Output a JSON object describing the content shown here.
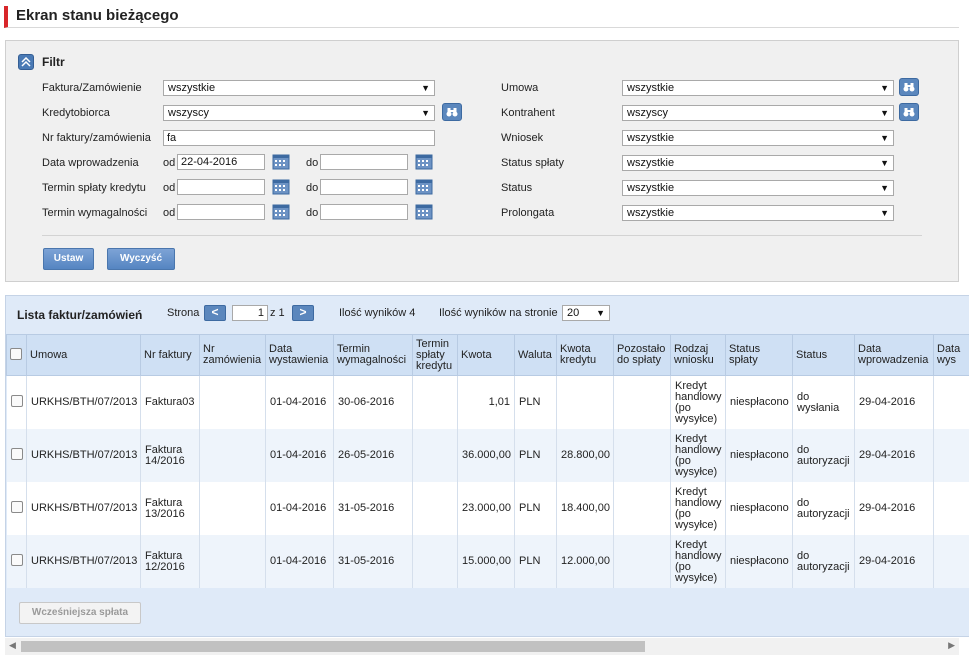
{
  "page": {
    "title": "Ekran stanu bieżącego"
  },
  "filter": {
    "title": "Filtr",
    "faktura_label": "Faktura/Zamówienie",
    "faktura_value": "wszystkie",
    "kredytobiorca_label": "Kredytobiorca",
    "kredytobiorca_value": "wszyscy",
    "nr_label": "Nr faktury/zamówienia",
    "nr_value": "fa",
    "data_wpr_label": "Data wprowadzenia",
    "termin_splaty_label": "Termin spłaty kredytu",
    "termin_wym_label": "Termin wymagalności",
    "od_label": "od",
    "do_label": "do",
    "data_wpr_od_value": "22-04-2016",
    "umowa_label": "Umowa",
    "umowa_value": "wszystkie",
    "kontrahent_label": "Kontrahent",
    "kontrahent_value": "wszyscy",
    "wniosek_label": "Wniosek",
    "wniosek_value": "wszystkie",
    "status_splaty_label": "Status spłaty",
    "status_splaty_value": "wszystkie",
    "status_label": "Status",
    "status_value": "wszystkie",
    "prolongata_label": "Prolongata",
    "prolongata_value": "wszystkie",
    "set_button": "Ustaw",
    "clear_button": "Wyczyść"
  },
  "list": {
    "title": "Lista faktur/zamówień",
    "strona_label": "Strona",
    "prev": "<",
    "next": ">",
    "page_value": "1",
    "of_label": "z 1",
    "results_label": "Ilość wyników 4",
    "per_page_label": "Ilość wyników na stronie",
    "per_page_value": "20",
    "columns": [
      "Umowa",
      "Nr faktury",
      "Nr zamówienia",
      "Data wystawienia",
      "Termin wymagalności",
      "Termin spłaty kredytu",
      "Kwota",
      "Waluta",
      "Kwota kredytu",
      "Pozostało do spłaty",
      "Rodzaj wniosku",
      "Status spłaty",
      "Status",
      "Data wprowadzenia",
      "Data wys"
    ],
    "rows": [
      [
        "URKHS/BTH/07/2013",
        "Faktura03",
        "",
        "01-04-2016",
        "30-06-2016",
        "",
        "1,01",
        "PLN",
        "",
        "",
        "Kredyt handlowy (po wysyłce)",
        "niespłacono",
        "do wysłania",
        "29-04-2016",
        ""
      ],
      [
        "URKHS/BTH/07/2013",
        "Faktura 14/2016",
        "",
        "01-04-2016",
        "26-05-2016",
        "",
        "36.000,00",
        "PLN",
        "28.800,00",
        "",
        "Kredyt handlowy (po wysyłce)",
        "niespłacono",
        "do autoryzacji",
        "29-04-2016",
        ""
      ],
      [
        "URKHS/BTH/07/2013",
        "Faktura 13/2016",
        "",
        "01-04-2016",
        "31-05-2016",
        "",
        "23.000,00",
        "PLN",
        "18.400,00",
        "",
        "Kredyt handlowy (po wysyłce)",
        "niespłacono",
        "do autoryzacji",
        "29-04-2016",
        ""
      ],
      [
        "URKHS/BTH/07/2013",
        "Faktura 12/2016",
        "",
        "01-04-2016",
        "31-05-2016",
        "",
        "15.000,00",
        "PLN",
        "12.000,00",
        "",
        "Kredyt handlowy (po wysyłce)",
        "niespłacono",
        "do autoryzacji",
        "29-04-2016",
        ""
      ]
    ],
    "early_button": "Wcześniejsza spłata"
  },
  "colors": {
    "accent": "#d8262a",
    "button": "#5585c2",
    "header_bg": "#cfe0f4",
    "panel_bg": "#dfeaf8"
  },
  "icons": {
    "collapse": "chevron-up-icon",
    "search": "binoculars-icon",
    "date": "calendar-icon"
  }
}
